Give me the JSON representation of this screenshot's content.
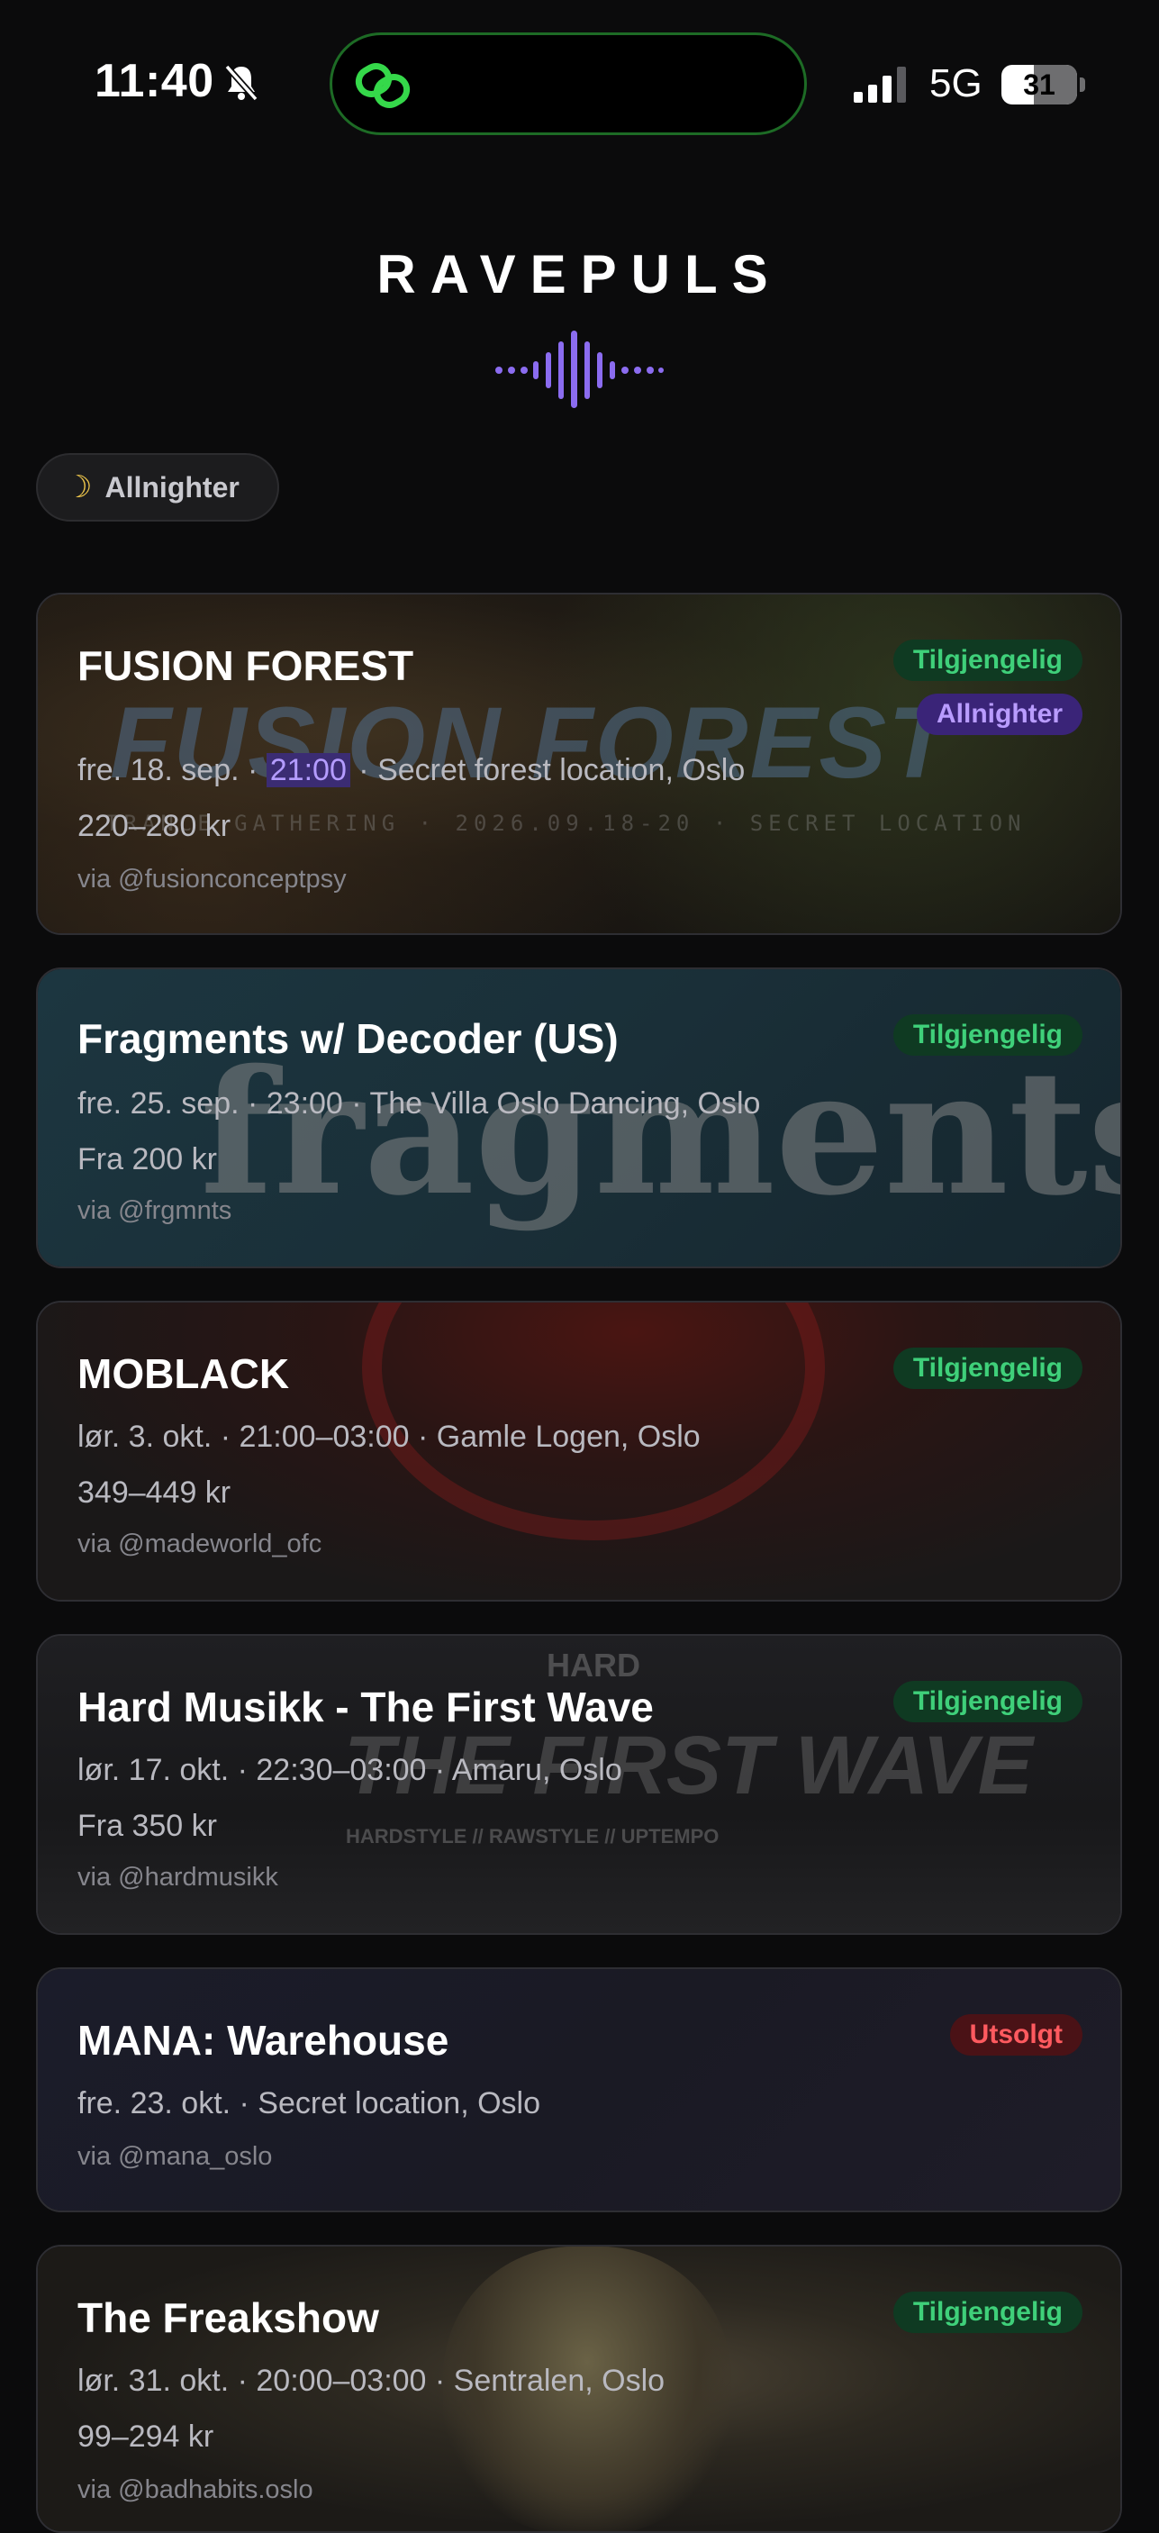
{
  "status_bar": {
    "time": "11:40",
    "network": "5G",
    "battery": "31",
    "icons": [
      "bell-slash-icon",
      "link-icon",
      "signal-icon",
      "battery-icon"
    ]
  },
  "header": {
    "brand": "RAVEPULS",
    "accent_color": "#8b6cf0"
  },
  "filters": {
    "allnighter_label": "Allnighter",
    "icon": "moon-icon"
  },
  "events": [
    {
      "title": "FUSION FOREST",
      "status": "Tilgjengelig",
      "tag": "Allnighter",
      "date": "fre. 18. sep.",
      "time": "21:00",
      "location": "Secret forest location, Oslo",
      "price": "220–280 kr",
      "source": "via @fusionconceptpsy",
      "poster_text": "FUSION FOREST",
      "poster_subtext": "TRANCE GATHERING · 2026.09.18-20 · SECRET LOCATION"
    },
    {
      "title": "Fragments w/ Decoder (US)",
      "status": "Tilgjengelig",
      "meta": "fre. 25. sep. · 23:00 · The Villa Oslo Dancing, Oslo",
      "price": "Fra 200 kr",
      "source": "via @frgmnts",
      "poster_text": "fragments."
    },
    {
      "title": "MOBLACK",
      "status": "Tilgjengelig",
      "meta": "lør. 3. okt. · 21:00–03:00 · Gamle Logen, Oslo",
      "price": "349–449 kr",
      "source": "via @madeworld_ofc"
    },
    {
      "title": "Hard Musikk - The First Wave",
      "status": "Tilgjengelig",
      "meta": "lør. 17. okt. · 22:30–03:00 · Amaru, Oslo",
      "price": "Fra 350 kr",
      "source": "via @hardmusikk",
      "poster_top": "HARD",
      "poster_text": "THE FIRST WAVE",
      "poster_subtext": "HARDSTYLE // RAWSTYLE // UPTEMPO"
    },
    {
      "title": "MANA: Warehouse",
      "status": "Utsolgt",
      "meta": "fre. 23. okt. · Secret location, Oslo",
      "source": "via @mana_oslo"
    },
    {
      "title": "The Freakshow",
      "status": "Tilgjengelig",
      "meta": "lør. 31. okt. · 20:00–03:00 · Sentralen, Oslo",
      "price": "99–294 kr",
      "source": "via @badhabits.oslo"
    }
  ]
}
